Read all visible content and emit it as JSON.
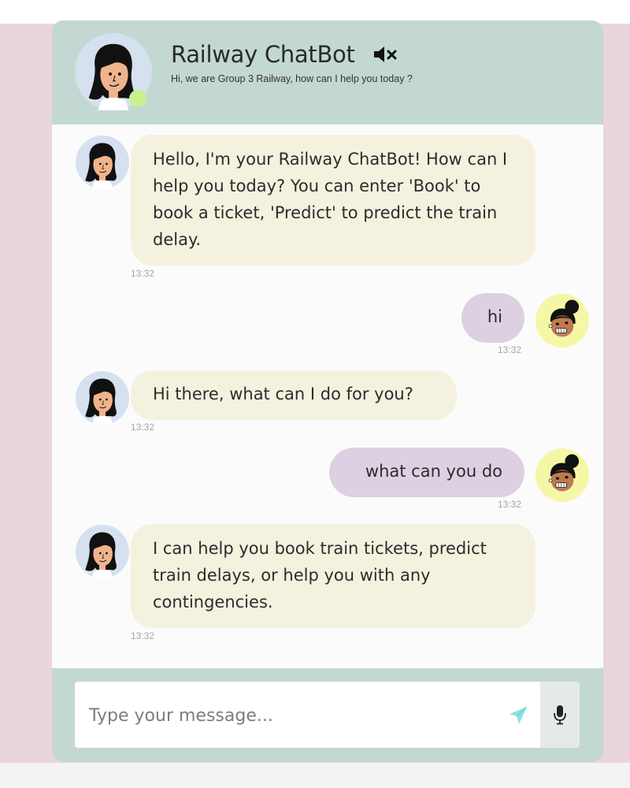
{
  "header": {
    "title": "Railway ChatBot",
    "subtitle": "Hi, we are Group 3 Railway, how can I help you today ?",
    "mute_icon": "speaker-muted-icon",
    "status": "online"
  },
  "messages": [
    {
      "sender": "bot",
      "text": "Hello, I'm your Railway ChatBot! How can I help you today? You can enter 'Book' to book a ticket, 'Predict' to predict the train delay.",
      "time": "13:32"
    },
    {
      "sender": "user",
      "text": "hi",
      "time": "13:32"
    },
    {
      "sender": "bot",
      "text": "Hi there, what can I do for you?",
      "time": "13:32"
    },
    {
      "sender": "user",
      "text": "what can you do",
      "time": "13:32"
    },
    {
      "sender": "bot",
      "text": "I can help you book train tickets, predict train delays, or help you with any contingencies.",
      "time": "13:32"
    }
  ],
  "footer": {
    "input_placeholder": "Type your message...",
    "input_value": "",
    "send_icon": "send-icon",
    "mic_icon": "microphone-icon"
  },
  "colors": {
    "page_background": "#e9d5de",
    "header_footer": "#c3d8d2",
    "bot_bubble": "#f4f1df",
    "user_bubble": "#ddd0e2",
    "send_accent": "#8fe0e0",
    "online": "#c8f08c"
  }
}
